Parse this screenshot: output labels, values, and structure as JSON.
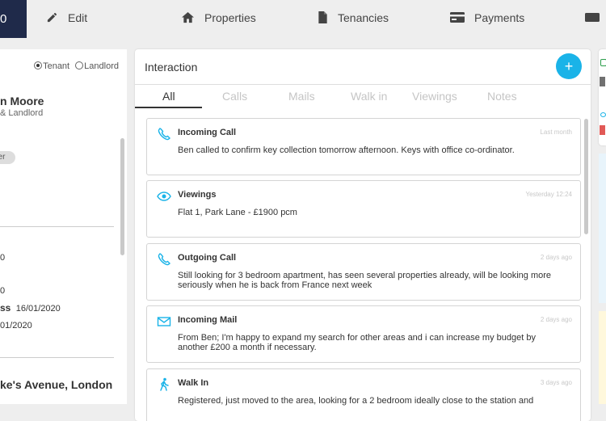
{
  "nav": {
    "current": "0",
    "items": [
      {
        "label": "Edit",
        "icon": "pencil-icon"
      },
      {
        "label": "Properties",
        "icon": "home-icon"
      },
      {
        "label": "Tenancies",
        "icon": "document-icon"
      },
      {
        "label": "Payments",
        "icon": "credit-card-icon"
      }
    ]
  },
  "left": {
    "radio_tenant": "Tenant",
    "radio_landlord": "Landlord",
    "name": "n Moore",
    "role": "& Landlord",
    "pill": "ner",
    "row1": "0",
    "row2": "0",
    "row3_label": "ss",
    "row3_value": "16/01/2020",
    "row4": "01/2020",
    "address": "ke's Avenue, London"
  },
  "interaction": {
    "title": "Interaction",
    "add_label": "+",
    "tabs": [
      "All",
      "Calls",
      "Mails",
      "Walk in",
      "Viewings",
      "Notes"
    ],
    "entries": [
      {
        "type": "Incoming Call",
        "icon": "phone-icon",
        "time": "Last month",
        "body": "Ben called to confirm key collection tomorrow afternoon. Keys with office co-ordinator."
      },
      {
        "type": "Viewings",
        "icon": "eye-icon",
        "time": "Yesterday 12:24",
        "body": "Flat 1, Park Lane - £1900 pcm"
      },
      {
        "type": "Outgoing Call",
        "icon": "phone-icon",
        "time": "2 days ago",
        "body": "Still looking for 3 bedroom apartment, has seen several properties already, will be looking more seriously when he is back from France next week"
      },
      {
        "type": "Incoming Mail",
        "icon": "mail-icon",
        "time": "2 days ago",
        "body": "From Ben; I'm happy to expand my search for other areas and i can increase my budget by another £200 a month if necessary."
      },
      {
        "type": "Walk In",
        "icon": "walking-icon",
        "time": "3 days ago",
        "body": "Registered, just moved to the area, looking for a 2 bedroom ideally close to the station and"
      }
    ]
  },
  "colors": {
    "accent": "#1ab3e8",
    "nav_dark": "#1f2a4a"
  }
}
